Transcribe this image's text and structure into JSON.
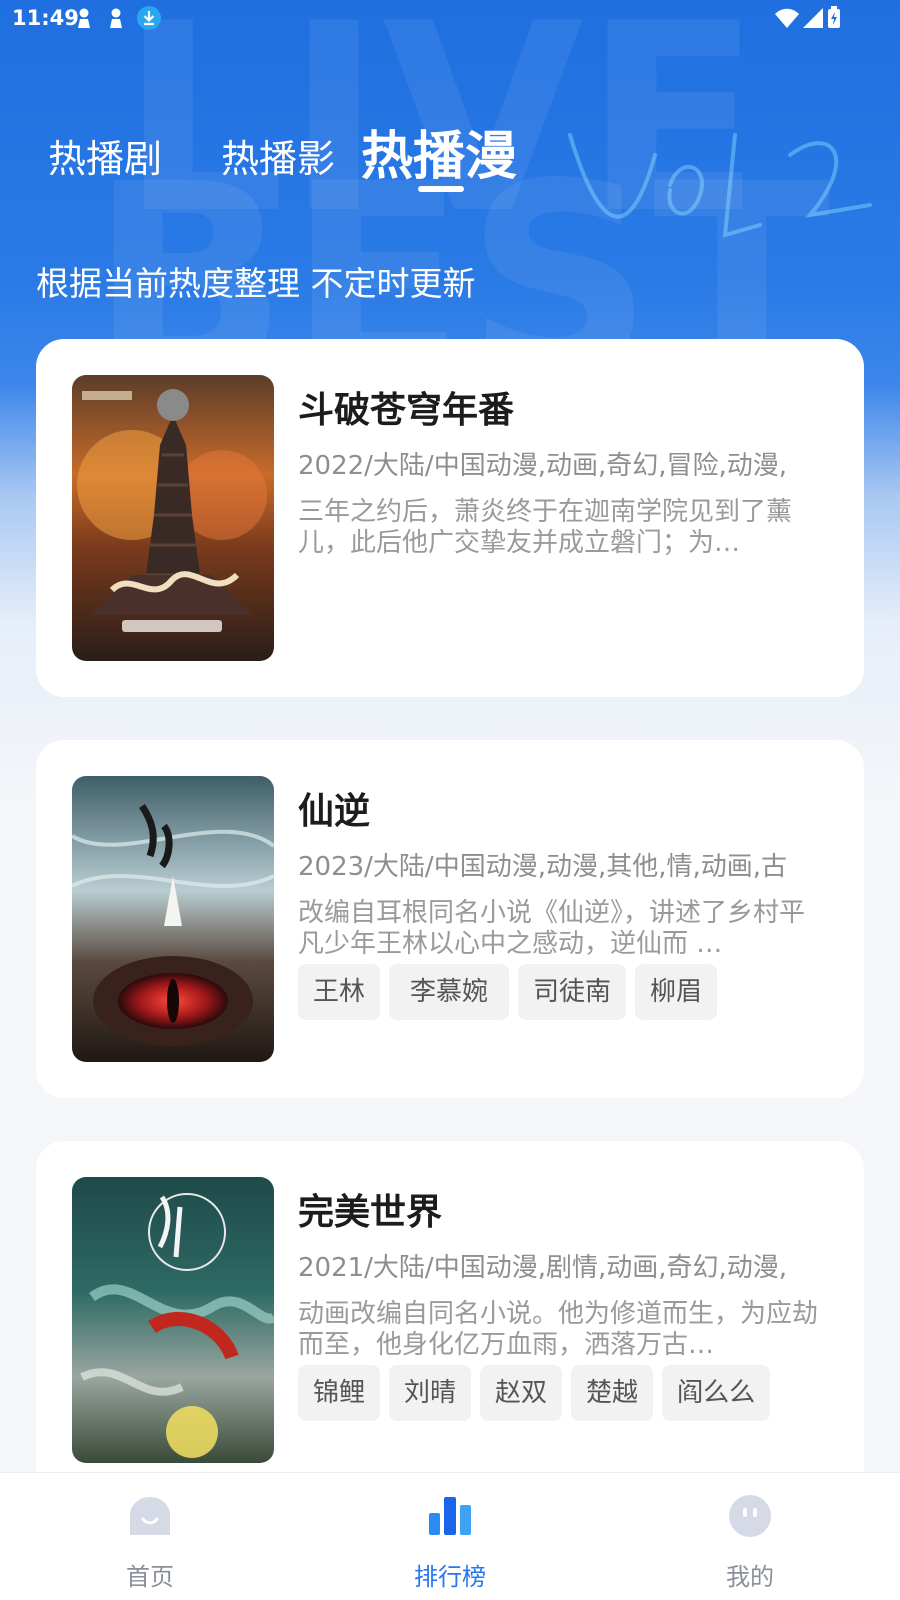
{
  "status_bar": {
    "time": "11:49"
  },
  "tabs": [
    {
      "label": "热播剧"
    },
    {
      "label": "热播影"
    },
    {
      "label": "热播漫"
    }
  ],
  "subtitle": "根据当前热度整理 不定时更新",
  "items": [
    {
      "title": "斗破苍穹年番",
      "meta": "2022/大陆/中国动漫,动画,奇幻,冒险,动漫,",
      "desc": "三年之约后，萧炎终于在迦南学院见到了薰儿，此后他广交挚友并成立磐门；为…",
      "tags": []
    },
    {
      "title": "仙逆",
      "meta": "2023/大陆/中国动漫,动漫,其他,情,动画,古",
      "desc": "改编自耳根同名小说《仙逆》，讲述了乡村平凡少年王林以心中之感动，逆仙而 …",
      "tags": [
        "王林",
        "李慕婉",
        "司徒南",
        "柳眉"
      ]
    },
    {
      "title": "完美世界",
      "meta": "2021/大陆/中国动漫,剧情,动画,奇幻,动漫,",
      "desc": "动画改编自同名小说。他为修道而生，为应劫而至，他身化亿万血雨，洒落万古…",
      "tags": [
        "锦鲤",
        "刘晴",
        "赵双",
        "楚越",
        "阎么么"
      ]
    }
  ],
  "bottom_nav": [
    {
      "label": "首页",
      "icon": "home-icon"
    },
    {
      "label": "排行榜",
      "icon": "ranking-icon",
      "active": true
    },
    {
      "label": "我的",
      "icon": "profile-icon"
    }
  ],
  "colors": {
    "accent": "#2677f0",
    "hero": "#1f6fe0"
  }
}
